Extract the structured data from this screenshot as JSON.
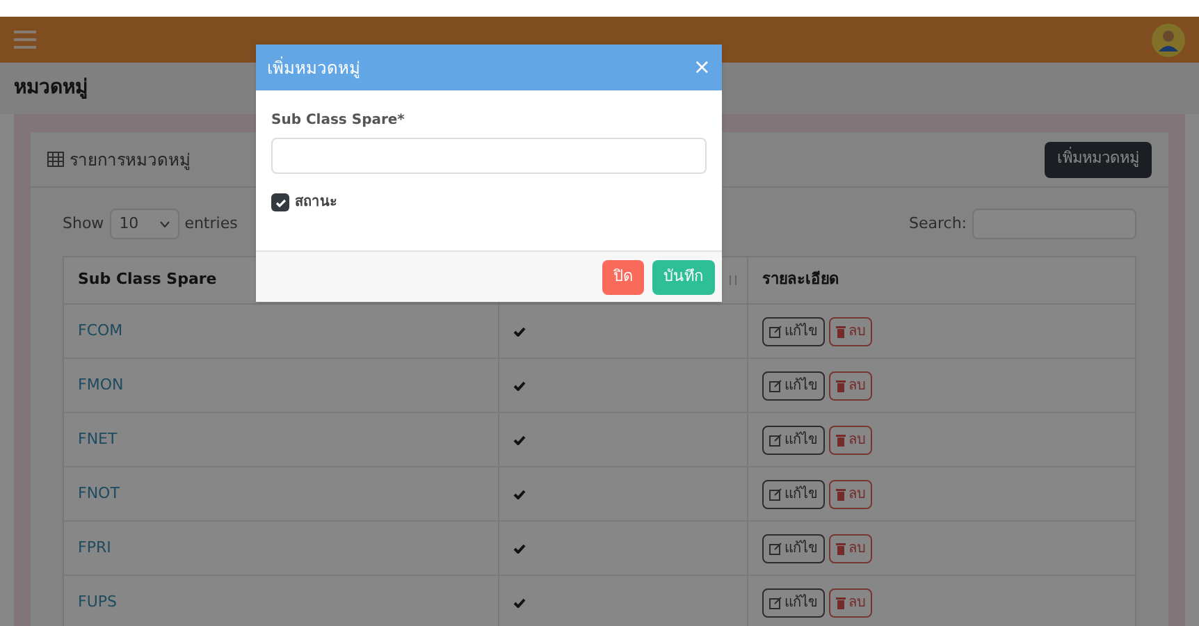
{
  "page_title": "หมวดหมู่",
  "card": {
    "title": "รายการหมวดหมู่",
    "add_button": "เพิ่มหมวดหมู่"
  },
  "table_controls": {
    "show_label": "Show",
    "page_size": "10",
    "entries_label": "entries",
    "search_label": "Search:"
  },
  "table": {
    "column_1": "Sub Class Spare",
    "column_3": "รายละเอียด",
    "rows": [
      {
        "name": "FCOM",
        "active": true,
        "edit": "แก้ไข",
        "delete": "ลบ"
      },
      {
        "name": "FMON",
        "active": true,
        "edit": "แก้ไข",
        "delete": "ลบ"
      },
      {
        "name": "FNET",
        "active": true,
        "edit": "แก้ไข",
        "delete": "ลบ"
      },
      {
        "name": "FNOT",
        "active": true,
        "edit": "แก้ไข",
        "delete": "ลบ"
      },
      {
        "name": "FPRI",
        "active": true,
        "edit": "แก้ไข",
        "delete": "ลบ"
      },
      {
        "name": "FUPS",
        "active": true,
        "edit": "แก้ไข",
        "delete": "ลบ"
      }
    ]
  },
  "modal": {
    "title": "เพิ่มหมวดหมู่",
    "close": "×",
    "field_label": "Sub Class Spare*",
    "status_label": "สถานะ",
    "status_checked": true,
    "buttons": [
      {
        "kind": "close",
        "label": "ปิด"
      },
      {
        "kind": "save",
        "label": "บันทึก"
      }
    ]
  }
}
